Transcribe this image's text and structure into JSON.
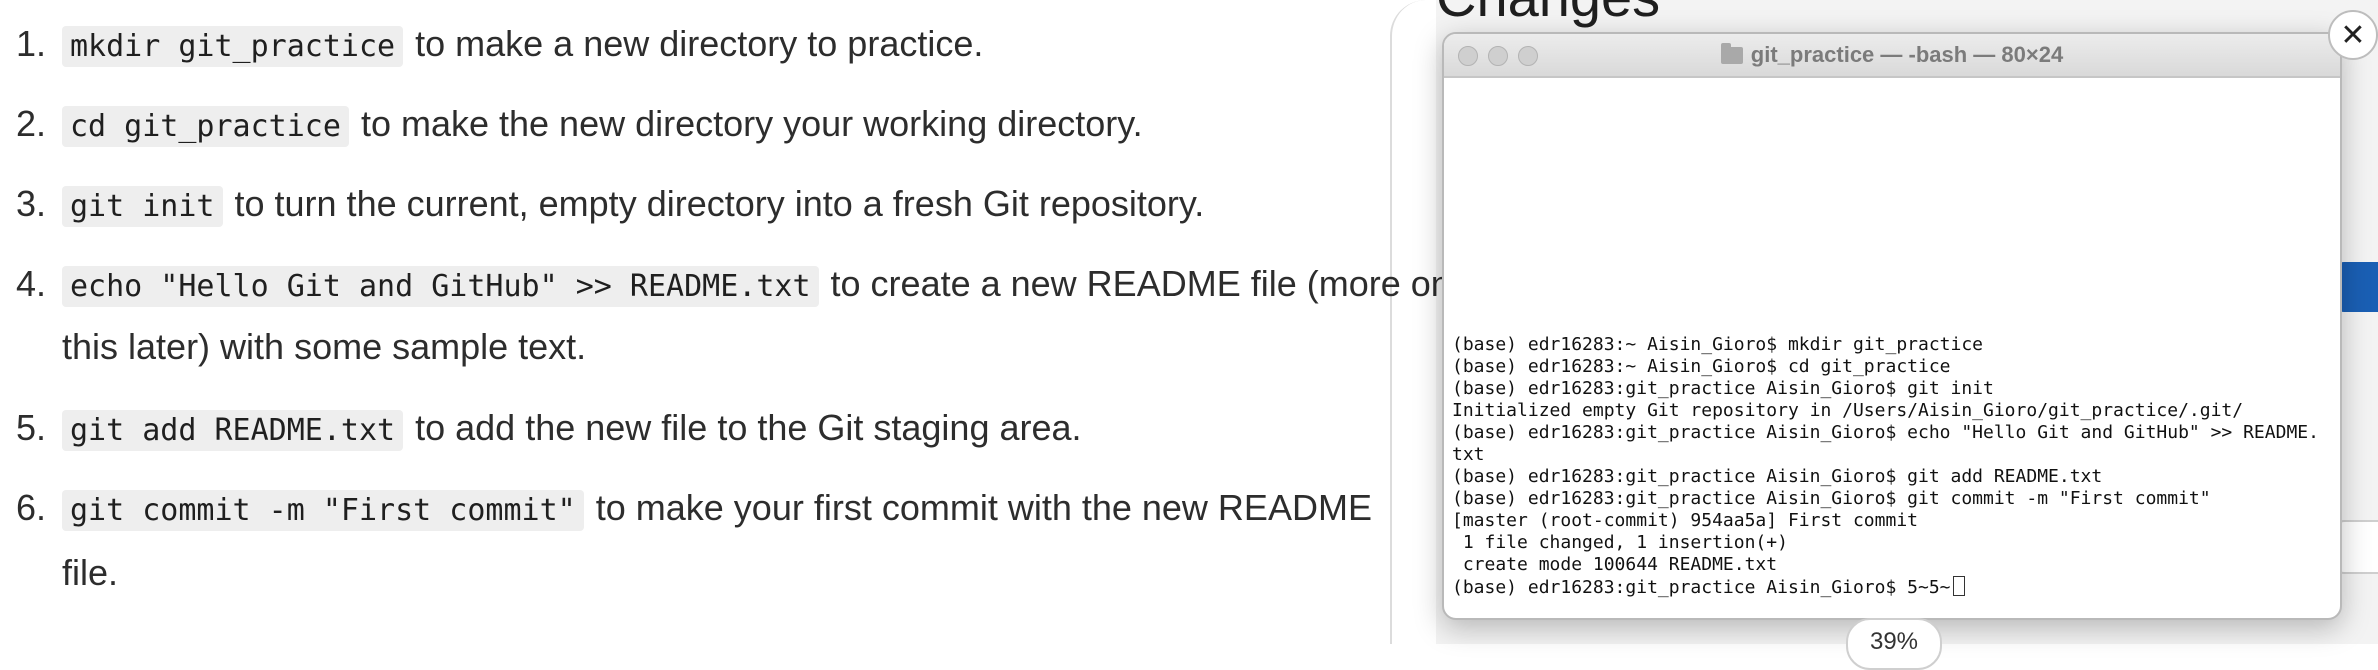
{
  "tutorial": {
    "steps": [
      {
        "number": "1.",
        "command": "mkdir git_practice",
        "text": "to make a new directory to practice."
      },
      {
        "number": "2.",
        "command": "cd git_practice",
        "text": "to make the new directory your working directory."
      },
      {
        "number": "3.",
        "command": "git init",
        "text": "to turn the current, empty directory into a fresh Git repository."
      },
      {
        "number": "4.",
        "command": "echo \"Hello Git and GitHub\" >> README.txt",
        "text": "to create a new README file (more on",
        "continuation": "this later) with some sample text."
      },
      {
        "number": "5.",
        "command": "git add README.txt",
        "text": "to add the new file to the Git staging area."
      },
      {
        "number": "6.",
        "command": "git commit -m \"First commit\"",
        "text": "to make your first commit with the new README",
        "continuation": "file."
      }
    ]
  },
  "background": {
    "heading": "Changes",
    "zoom": "39%"
  },
  "terminal": {
    "title": "git_practice — -bash — 80×24",
    "lines": [
      "(base) edr16283:~ Aisin_Gioro$ mkdir git_practice",
      "(base) edr16283:~ Aisin_Gioro$ cd git_practice",
      "(base) edr16283:git_practice Aisin_Gioro$ git init",
      "Initialized empty Git repository in /Users/Aisin_Gioro/git_practice/.git/",
      "(base) edr16283:git_practice Aisin_Gioro$ echo \"Hello Git and GitHub\" >> README.",
      "txt",
      "(base) edr16283:git_practice Aisin_Gioro$ git add README.txt",
      "(base) edr16283:git_practice Aisin_Gioro$ git commit -m \"First commit\"",
      "[master (root-commit) 954aa5a] First commit",
      " 1 file changed, 1 insertion(+)",
      " create mode 100644 README.txt",
      "(base) edr16283:git_practice Aisin_Gioro$ 5~5~"
    ]
  },
  "icons": {
    "close": "close-icon",
    "folder": "folder-icon"
  },
  "colors": {
    "code_bg": "#eeeeee",
    "terminal_text": "#111111",
    "accent_blue": "#1a5fb4"
  }
}
